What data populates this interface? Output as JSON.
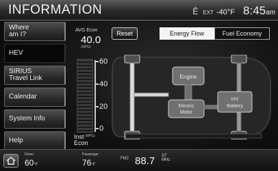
{
  "header": {
    "title": "INFORMATION",
    "ext_icon": "Ê",
    "ext_label": "EXT",
    "ext_temp": "-40°F",
    "time": "8:45",
    "ampm": "am"
  },
  "sidebar": {
    "items": [
      {
        "label": "Where\nam I?"
      },
      {
        "label": "HEV"
      },
      {
        "label": "SIRIUS\nTravel Link"
      },
      {
        "label": "Calendar"
      },
      {
        "label": "System Info"
      },
      {
        "label": "Help"
      }
    ]
  },
  "avg_econ": {
    "label": "AVG Econ",
    "value": "40.0",
    "unit": "(MPG)"
  },
  "reset": {
    "label": "Reset"
  },
  "tabs": [
    {
      "label": "Energy Flow",
      "selected": true
    },
    {
      "label": "Fuel Economy",
      "selected": false
    }
  ],
  "gauge": {
    "ticks": [
      "60",
      "40",
      "20",
      "0"
    ],
    "label_line1": "Inst",
    "label_line2": "Econ",
    "unit": "(MPG)"
  },
  "diagram": {
    "engine": "Engine",
    "motor": "Electric\nMotor",
    "battery": "HV\nBattery"
  },
  "bottom": {
    "driver_label": "Driver",
    "driver_temp": "60",
    "driver_unit": "°F",
    "passenger_label": "Passenger",
    "passenger_temp": "76",
    "passenger_unit": "°F",
    "band": "FM2",
    "frequency": "88.7",
    "st": "ST",
    "mhz": "MHz"
  },
  "colors": {
    "component_fill": "#707070",
    "outline": "#cfcfcf"
  }
}
